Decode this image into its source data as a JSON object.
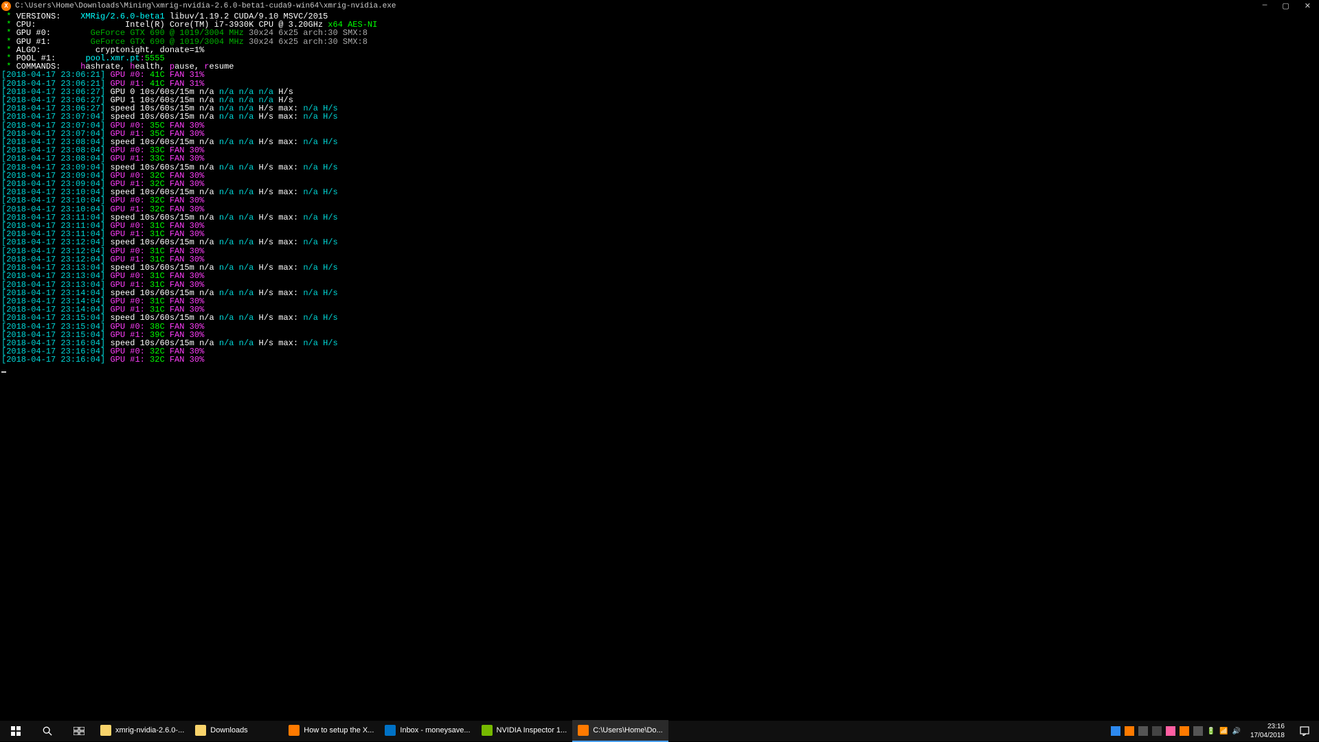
{
  "window": {
    "title": "C:\\Users\\Home\\Downloads\\Mining\\xmrig-nvidia-2.6.0-beta1-cuda9-win64\\xmrig-nvidia.exe"
  },
  "header": {
    "versions_label": "VERSIONS:",
    "versions_app": "XMRig/2.6.0-beta1",
    "versions_rest": " libuv/1.19.2 CUDA/9.10 MSVC/2015",
    "cpu_label": "CPU:",
    "cpu_name": "Intel(R) Core(TM) i7-3930K CPU @ 3.20GHz ",
    "cpu_flags": "x64 AES-NI",
    "gpu0_label": "GPU #0:",
    "gpu1_label": "GPU #1:",
    "gpu_name": "GeForce GTX 690 @ 1019/3004 MHz",
    "gpu_arch": " 30x24 6x25 arch:30 SMX:8",
    "algo_label": "ALGO:",
    "algo_val": "cryptonight, donate=1%",
    "pool_label": "POOL #1:",
    "pool_host": "pool.xmr.pt",
    "pool_port": "5555",
    "commands_label": "COMMANDS:",
    "cmd_h": "h",
    "cmd_hashrate": "ashrate, ",
    "cmd_he": "h",
    "cmd_health": "ealth, ",
    "cmd_p": "p",
    "cmd_pause": "ause, ",
    "cmd_r": "r",
    "cmd_resume": "esume"
  },
  "log": [
    {
      "ts": "2018-04-17 23:06:21",
      "type": "gpu",
      "gpu": "#0",
      "temp": "41C",
      "fan": "31%"
    },
    {
      "ts": "2018-04-17 23:06:21",
      "type": "gpu",
      "gpu": "#1",
      "temp": "41C",
      "fan": "31%"
    },
    {
      "ts": "2018-04-17 23:06:27",
      "type": "gpuspeed",
      "text": "GPU 0 10s/60s/15m "
    },
    {
      "ts": "2018-04-17 23:06:27",
      "type": "gpuspeed",
      "text": "GPU 1 10s/60s/15m "
    },
    {
      "ts": "2018-04-17 23:06:27",
      "type": "speed"
    },
    {
      "ts": "2018-04-17 23:07:04",
      "type": "speed"
    },
    {
      "ts": "2018-04-17 23:07:04",
      "type": "gpu",
      "gpu": "#0",
      "temp": "35C",
      "fan": "30%"
    },
    {
      "ts": "2018-04-17 23:07:04",
      "type": "gpu",
      "gpu": "#1",
      "temp": "35C",
      "fan": "30%"
    },
    {
      "ts": "2018-04-17 23:08:04",
      "type": "speed"
    },
    {
      "ts": "2018-04-17 23:08:04",
      "type": "gpu",
      "gpu": "#0",
      "temp": "33C",
      "fan": "30%"
    },
    {
      "ts": "2018-04-17 23:08:04",
      "type": "gpu",
      "gpu": "#1",
      "temp": "33C",
      "fan": "30%"
    },
    {
      "ts": "2018-04-17 23:09:04",
      "type": "speed"
    },
    {
      "ts": "2018-04-17 23:09:04",
      "type": "gpu",
      "gpu": "#0",
      "temp": "32C",
      "fan": "30%"
    },
    {
      "ts": "2018-04-17 23:09:04",
      "type": "gpu",
      "gpu": "#1",
      "temp": "32C",
      "fan": "30%"
    },
    {
      "ts": "2018-04-17 23:10:04",
      "type": "speed"
    },
    {
      "ts": "2018-04-17 23:10:04",
      "type": "gpu",
      "gpu": "#0",
      "temp": "32C",
      "fan": "30%"
    },
    {
      "ts": "2018-04-17 23:10:04",
      "type": "gpu",
      "gpu": "#1",
      "temp": "32C",
      "fan": "30%"
    },
    {
      "ts": "2018-04-17 23:11:04",
      "type": "speed"
    },
    {
      "ts": "2018-04-17 23:11:04",
      "type": "gpu",
      "gpu": "#0",
      "temp": "31C",
      "fan": "30%"
    },
    {
      "ts": "2018-04-17 23:11:04",
      "type": "gpu",
      "gpu": "#1",
      "temp": "31C",
      "fan": "30%"
    },
    {
      "ts": "2018-04-17 23:12:04",
      "type": "speed"
    },
    {
      "ts": "2018-04-17 23:12:04",
      "type": "gpu",
      "gpu": "#0",
      "temp": "31C",
      "fan": "30%"
    },
    {
      "ts": "2018-04-17 23:12:04",
      "type": "gpu",
      "gpu": "#1",
      "temp": "31C",
      "fan": "30%"
    },
    {
      "ts": "2018-04-17 23:13:04",
      "type": "speed"
    },
    {
      "ts": "2018-04-17 23:13:04",
      "type": "gpu",
      "gpu": "#0",
      "temp": "31C",
      "fan": "30%"
    },
    {
      "ts": "2018-04-17 23:13:04",
      "type": "gpu",
      "gpu": "#1",
      "temp": "31C",
      "fan": "30%"
    },
    {
      "ts": "2018-04-17 23:14:04",
      "type": "speed"
    },
    {
      "ts": "2018-04-17 23:14:04",
      "type": "gpu",
      "gpu": "#0",
      "temp": "31C",
      "fan": "30%"
    },
    {
      "ts": "2018-04-17 23:14:04",
      "type": "gpu",
      "gpu": "#1",
      "temp": "31C",
      "fan": "30%"
    },
    {
      "ts": "2018-04-17 23:15:04",
      "type": "speed"
    },
    {
      "ts": "2018-04-17 23:15:04",
      "type": "gpu",
      "gpu": "#0",
      "temp": "38C",
      "fan": "30%"
    },
    {
      "ts": "2018-04-17 23:15:04",
      "type": "gpu",
      "gpu": "#1",
      "temp": "39C",
      "fan": "30%"
    },
    {
      "ts": "2018-04-17 23:16:04",
      "type": "speed"
    },
    {
      "ts": "2018-04-17 23:16:04",
      "type": "gpu",
      "gpu": "#0",
      "temp": "32C",
      "fan": "30%"
    },
    {
      "ts": "2018-04-17 23:16:04",
      "type": "gpu",
      "gpu": "#1",
      "temp": "32C",
      "fan": "30%"
    }
  ],
  "speed_template": {
    "pre": "speed 10s/60s/15m ",
    "na": "n/a",
    "hs": " H/s ",
    "max": "max: ",
    "maxna": "n/a H/s"
  },
  "gpuspeed_template": {
    "na": "n/a n/a n/a",
    "hs": " H/s"
  },
  "taskbar": {
    "apps": [
      {
        "label": "xmrig-nvidia-2.6.0-...",
        "icon": "folder"
      },
      {
        "label": "Downloads",
        "icon": "folder"
      },
      {
        "label": "How to setup the X...",
        "icon": "firefox"
      },
      {
        "label": "Inbox - moneysave...",
        "icon": "outlook"
      },
      {
        "label": "NVIDIA Inspector 1...",
        "icon": "nvidia"
      },
      {
        "label": "C:\\Users\\Home\\Do...",
        "icon": "xmrig",
        "active": true
      }
    ],
    "clock": {
      "time": "23:16",
      "date": "17/04/2018"
    }
  }
}
